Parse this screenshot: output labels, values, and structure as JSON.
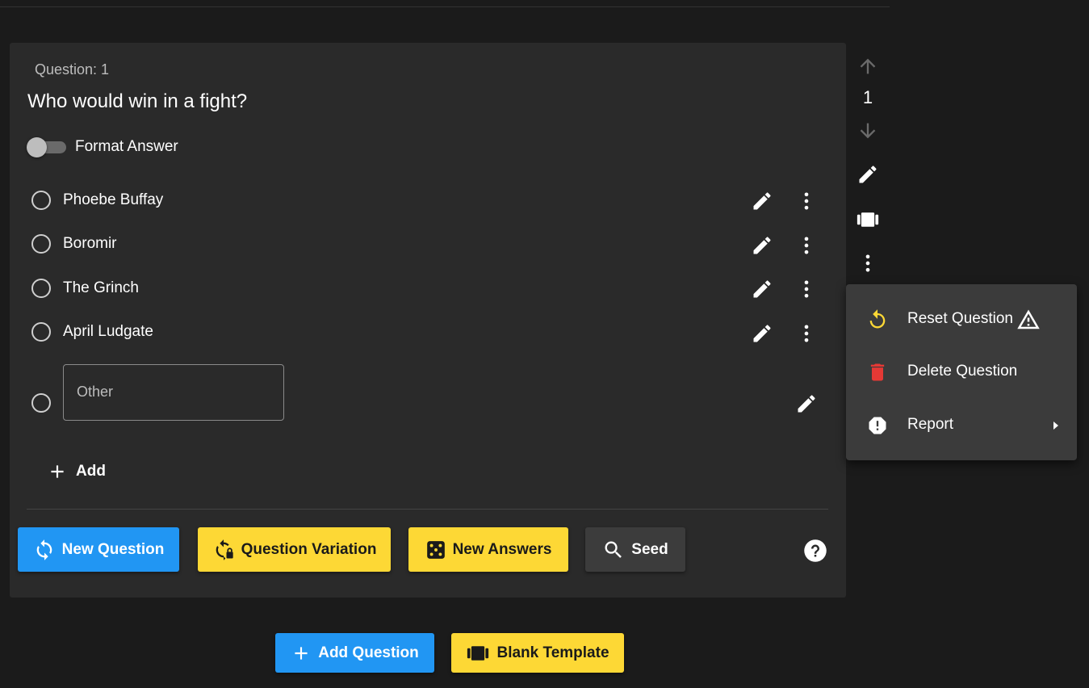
{
  "question": {
    "number_label": "Question: 1",
    "text": "Who would win in a fight?",
    "format_toggle_label": "Format Answer",
    "format_toggle_on": false
  },
  "answers": [
    {
      "label": "Phoebe Buffay"
    },
    {
      "label": "Boromir"
    },
    {
      "label": "The Grinch"
    },
    {
      "label": "April Ludgate"
    }
  ],
  "other": {
    "placeholder": "Other",
    "value": ""
  },
  "add_answer_label": "Add",
  "actions": {
    "new_question": "New Question",
    "question_variation": "Question Variation",
    "new_answers": "New Answers",
    "seed": "Seed"
  },
  "side_controls": {
    "order_number": "1"
  },
  "context_menu": {
    "reset": "Reset Question",
    "delete": "Delete Question",
    "report": "Report"
  },
  "bottom": {
    "add_question": "Add Question",
    "blank_template": "Blank Template"
  },
  "colors": {
    "primary": "#2196f3",
    "accent": "#fdd835",
    "danger": "#e53935",
    "reset_icon": "#fdd835"
  },
  "icons": [
    "arrow-up-icon",
    "arrow-down-icon",
    "pencil-icon",
    "template-icon",
    "more-vert-icon",
    "refresh-icon",
    "warning-icon",
    "trash-icon",
    "report-icon",
    "chevron-right-icon",
    "plus-icon",
    "sync-icon",
    "variation-icon",
    "dice-icon",
    "search-icon",
    "help-icon"
  ]
}
